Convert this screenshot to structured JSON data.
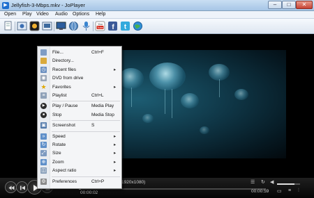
{
  "window": {
    "title": "Jellyfish-3-Mbps.mkv - JoPlayer",
    "controls": {
      "minimize": "–",
      "maximize": "□",
      "close": "✕"
    }
  },
  "menubar": [
    "Open",
    "Play",
    "Video",
    "Audio",
    "Options",
    "Help"
  ],
  "toolbar": {
    "icons": [
      "open-file-icon",
      "open-image-icon",
      "subtitles-icon",
      "screenshot-icon",
      "monitor-icon",
      "globe-search-icon",
      "microphone-icon",
      "youtube-icon",
      "facebook-icon",
      "twitter-icon",
      "web-icon"
    ],
    "youtube_label": "You Tube",
    "facebook_label": "f",
    "twitter_label": "t"
  },
  "context_menu": {
    "items": [
      {
        "label": "File...",
        "shortcut": "Ctrl+F",
        "submenu": false,
        "icon": "file-icon"
      },
      {
        "label": "Directory...",
        "shortcut": "",
        "submenu": false,
        "icon": "folder-icon"
      },
      {
        "label": "Recent files",
        "shortcut": "",
        "submenu": true,
        "icon": "recent-icon"
      },
      {
        "label": "DVD from drive",
        "shortcut": "",
        "submenu": false,
        "icon": "dvd-icon"
      },
      {
        "label": "Favorites",
        "shortcut": "",
        "submenu": true,
        "icon": "star-icon"
      },
      {
        "label": "Playlist",
        "shortcut": "Ctrl+L",
        "submenu": false,
        "icon": "playlist-icon"
      },
      {
        "label": "Play / Pause",
        "shortcut": "Media Play",
        "submenu": false,
        "icon": "play-pause-icon"
      },
      {
        "label": "Stop",
        "shortcut": "Media Stop",
        "submenu": false,
        "icon": "stop-icon"
      },
      {
        "label": "Screenshot",
        "shortcut": "S",
        "submenu": false,
        "icon": "screenshot-icon"
      },
      {
        "label": "Speed",
        "shortcut": "",
        "submenu": true,
        "icon": "speed-icon"
      },
      {
        "label": "Rotate",
        "shortcut": "",
        "submenu": true,
        "icon": "rotate-icon"
      },
      {
        "label": "Size",
        "shortcut": "",
        "submenu": true,
        "icon": "size-icon"
      },
      {
        "label": "Zoom",
        "shortcut": "",
        "submenu": true,
        "icon": "zoom-icon"
      },
      {
        "label": "Aspect ratio",
        "shortcut": "",
        "submenu": true,
        "icon": "aspect-ratio-icon"
      },
      {
        "label": "Preferences",
        "shortcut": "Ctrl+P",
        "submenu": false,
        "icon": "gear-icon"
      }
    ],
    "submenu_arrow": "▸"
  },
  "player": {
    "resolution": "1920x1080)",
    "time_current": "00:00:02",
    "time_total": "00:00:59",
    "progress": 0.01,
    "volume": 0.75
  },
  "colors": {
    "accent": "#1e6fd0",
    "youtube": "#d52b1e",
    "facebook": "#3b5998",
    "twitter": "#33aadd"
  }
}
